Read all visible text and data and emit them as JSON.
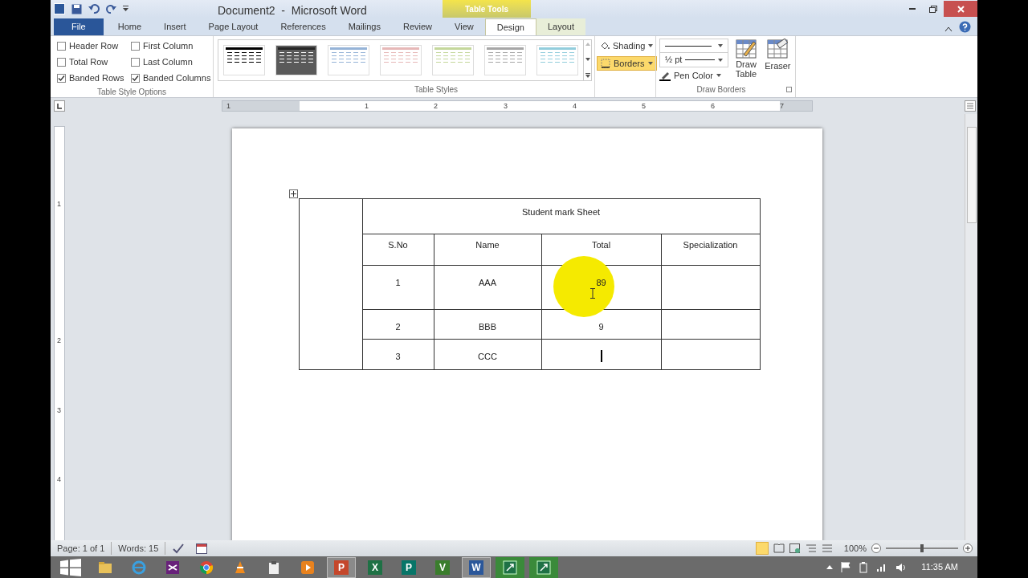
{
  "window": {
    "title": "Document2  -  Microsoft Word",
    "context_label": "Table Tools"
  },
  "tabs": [
    {
      "label": "File",
      "kind": "file",
      "selected": false
    },
    {
      "label": "Home",
      "kind": "tab",
      "selected": false
    },
    {
      "label": "Insert",
      "kind": "tab",
      "selected": false
    },
    {
      "label": "Page Layout",
      "kind": "tab",
      "selected": false
    },
    {
      "label": "References",
      "kind": "tab",
      "selected": false
    },
    {
      "label": "Mailings",
      "kind": "tab",
      "selected": false
    },
    {
      "label": "Review",
      "kind": "tab",
      "selected": false
    },
    {
      "label": "View",
      "kind": "tab",
      "selected": false
    },
    {
      "label": "Design",
      "kind": "context",
      "selected": true
    },
    {
      "label": "Layout",
      "kind": "context",
      "selected": false
    }
  ],
  "table_style_options": {
    "label": "Table Style Options",
    "options": [
      {
        "label": "Header Row",
        "checked": false
      },
      {
        "label": "First Column",
        "checked": false
      },
      {
        "label": "Total Row",
        "checked": false
      },
      {
        "label": "Last Column",
        "checked": false
      },
      {
        "label": "Banded Rows",
        "checked": true
      },
      {
        "label": "Banded Columns",
        "checked": true
      }
    ]
  },
  "table_styles": {
    "label": "Table Styles",
    "styles": [
      {
        "color": "#000000"
      },
      {
        "color": "#262626"
      },
      {
        "color": "#95b3d7"
      },
      {
        "color": "#e6b8b7"
      },
      {
        "color": "#c4d79b"
      },
      {
        "color": "#a6a6a6"
      },
      {
        "color": "#92cddc"
      }
    ],
    "buttons": [
      {
        "label": "Shading",
        "selected": false
      },
      {
        "label": "Borders",
        "selected": true
      }
    ]
  },
  "draw_borders": {
    "label": "Draw Borders",
    "weight": "½ pt",
    "pen_color": "Pen Color",
    "draw_table": "Draw Table",
    "eraser": "Eraser"
  },
  "ruler": {
    "horizontal": [
      "1",
      "1",
      "2",
      "3",
      "4",
      "5",
      "6",
      "7"
    ],
    "vertical": [
      "1",
      "2",
      "3",
      "4"
    ]
  },
  "document_table": {
    "title": "Student mark Sheet",
    "columns": [
      "S.No",
      "Name",
      "Total",
      "Specialization"
    ],
    "rows": [
      [
        "1",
        "AAA",
        "89",
        ""
      ],
      [
        "2",
        "BBB",
        "9",
        ""
      ],
      [
        "3",
        "CCC",
        "",
        ""
      ]
    ]
  },
  "status_bar": {
    "page": "Page: 1 of 1",
    "words": "Words: 15",
    "zoom": "100%",
    "zoom_slider": {
      "level": 0.5
    }
  },
  "taskbar": {
    "apps": [
      {
        "kind": "folder",
        "selected": false
      },
      {
        "kind": "browser",
        "selected": false
      },
      {
        "kind": "studio",
        "selected": false
      },
      {
        "kind": "chrome",
        "selected": false
      },
      {
        "kind": "cone",
        "selected": false
      },
      {
        "kind": "clipboard",
        "selected": false
      },
      {
        "kind": "media",
        "selected": false
      },
      {
        "kind": "letter",
        "letter": "P",
        "color": "#c5472b",
        "selected": true
      },
      {
        "kind": "letter",
        "letter": "X",
        "color": "#1e7145",
        "selected": false
      },
      {
        "kind": "letter",
        "letter": "P",
        "color": "#077568",
        "selected": false
      },
      {
        "kind": "letter",
        "letter": "V",
        "color": "#3a7d2c",
        "selected": false
      },
      {
        "kind": "letter",
        "letter": "W",
        "color": "#2b579a",
        "selected": true
      },
      {
        "kind": "green",
        "selected": false
      },
      {
        "kind": "green",
        "selected": false
      }
    ],
    "time": "11:35 AM"
  }
}
